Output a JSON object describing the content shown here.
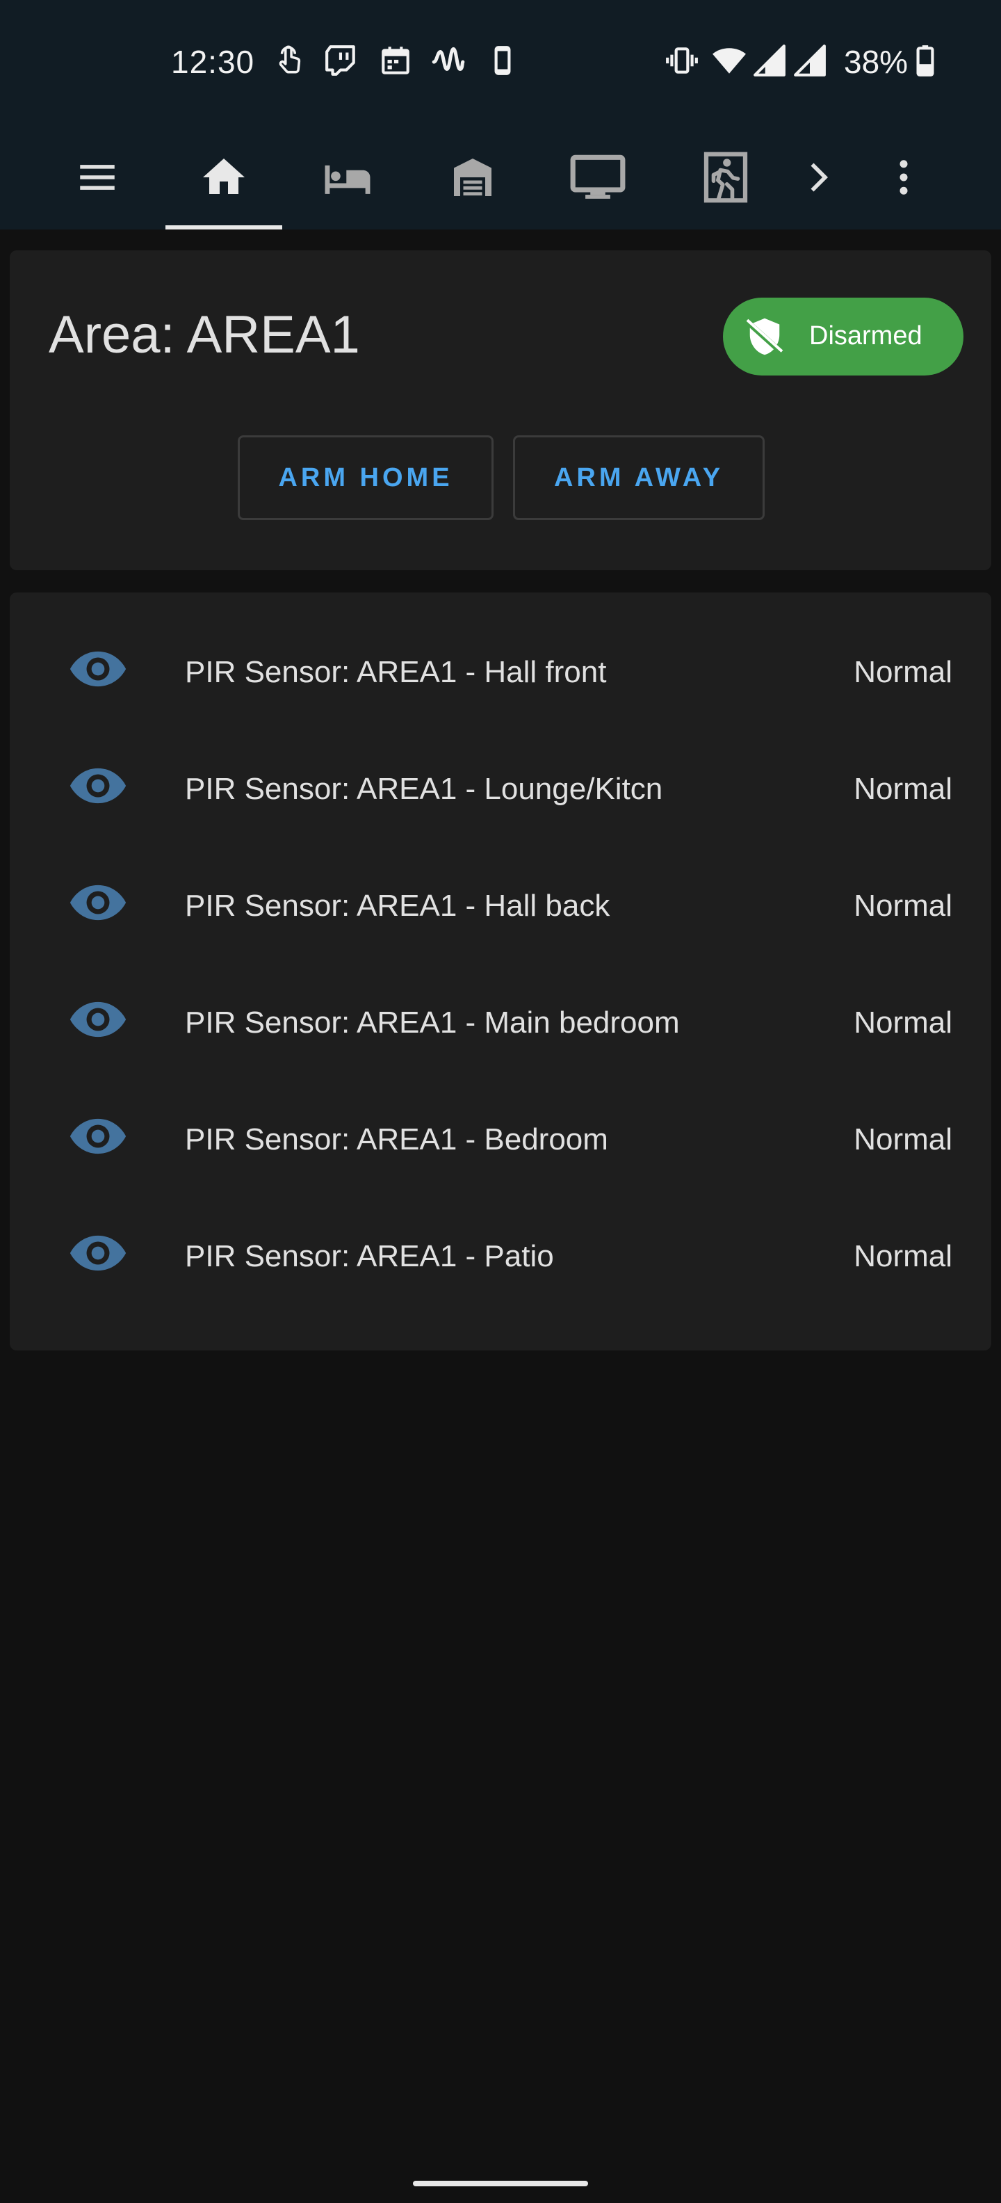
{
  "status_bar": {
    "time": "12:30",
    "battery_percent": "38%",
    "left_icons": [
      "touch-icon",
      "twitch-icon",
      "calendar-icon",
      "waveform-icon",
      "phone-icon"
    ],
    "right_icons": [
      "vibrate-icon",
      "wifi-icon",
      "signal-icon",
      "signal-icon",
      "battery-icon"
    ]
  },
  "nav": {
    "items": [
      {
        "icon": "menu-icon"
      },
      {
        "icon": "home-icon",
        "selected": true
      },
      {
        "icon": "bed-icon"
      },
      {
        "icon": "garage-icon"
      },
      {
        "icon": "monitor-icon"
      },
      {
        "icon": "exit-run-icon"
      },
      {
        "icon": "chevron-right-icon"
      },
      {
        "icon": "more-vert-icon"
      }
    ]
  },
  "alarm_panel": {
    "title": "Area: AREA1",
    "state": "Disarmed",
    "state_color": "#43a047",
    "state_icon": "shield-off-icon",
    "buttons": {
      "arm_home": "ARM HOME",
      "arm_away": "ARM AWAY"
    }
  },
  "sensors": [
    {
      "icon": "eye-icon",
      "name": "PIR Sensor: AREA1 - Hall front",
      "state": "Normal"
    },
    {
      "icon": "eye-icon",
      "name": "PIR Sensor: AREA1 - Lounge/Kitcn",
      "state": "Normal"
    },
    {
      "icon": "eye-icon",
      "name": "PIR Sensor: AREA1 - Hall back",
      "state": "Normal"
    },
    {
      "icon": "eye-icon",
      "name": "PIR Sensor: AREA1 - Main bedroom",
      "state": "Normal"
    },
    {
      "icon": "eye-icon",
      "name": "PIR Sensor: AREA1 - Bedroom",
      "state": "Normal"
    },
    {
      "icon": "eye-icon",
      "name": "PIR Sensor: AREA1 - Patio",
      "state": "Normal"
    }
  ],
  "colors": {
    "header_bg": "#111c24",
    "page_bg": "#111111",
    "card_bg": "#1e1e1e",
    "accent_blue": "#4aa6f0",
    "eye_icon": "#44739e"
  }
}
